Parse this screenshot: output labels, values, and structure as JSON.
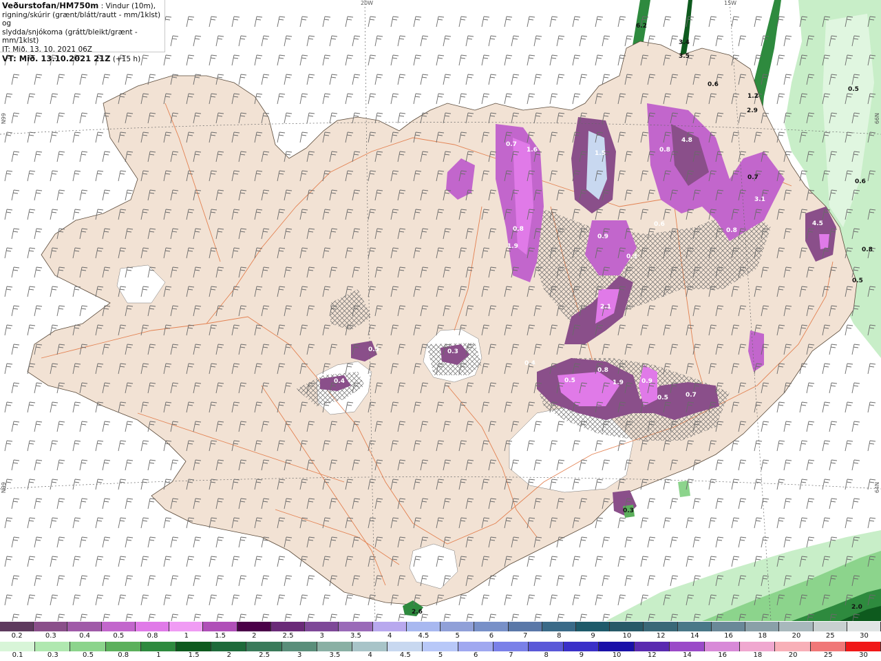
{
  "header": {
    "source": "Veðurstofan/HM750m",
    "description_line1": " : Vindur (10m),",
    "description_line2": "rigning/skúrir (grænt/blátt/rautt - mm/1klst) og",
    "description_line3": "slydda/snjókoma (grátt/bleikt/grænt - mm/1klst)",
    "initial_time": "IT: Mið. 13. 10. 2021 06Z",
    "valid_time_label": "VT: Mið. 13.10.2021 21Z",
    "valid_time_offset": "(+15 h)"
  },
  "graticule": {
    "lon_labels": [
      "20W",
      "15W"
    ],
    "lat_labels_left": [
      "N99",
      "N99"
    ],
    "lat_labels_right": [
      "66N",
      "64N"
    ]
  },
  "snow_scale": {
    "labels": [
      "0.2",
      "0.3",
      "0.4",
      "0.5",
      "0.8",
      "1",
      "1.5",
      "2",
      "2.5",
      "3",
      "3.5",
      "4",
      "4.5",
      "5",
      "6",
      "7",
      "8",
      "9",
      "10",
      "12",
      "14",
      "16",
      "18",
      "20",
      "25",
      "30"
    ],
    "colors": [
      "#5e3a5e",
      "#8a4f8a",
      "#a05aa8",
      "#c266cc",
      "#e07ae8",
      "#f09cf4",
      "#b04fb8",
      "#4a0048",
      "#6a2a78",
      "#7e4898",
      "#9a6ab8",
      "#b8a8ee",
      "#a8b8f0",
      "#90a0d8",
      "#7890c8",
      "#5a78a8",
      "#3a6a88",
      "#1e5a6a",
      "#285a68",
      "#3a6878",
      "#4a7888",
      "#6a8898",
      "#8aa0a8",
      "#a8b8bc",
      "#c8d0d0",
      "#e0e4e4"
    ]
  },
  "rain_scale": {
    "labels": [
      "0.1",
      "0.3",
      "0.5",
      "0.8",
      "1",
      "1.5",
      "2",
      "2.5",
      "3",
      "3.5",
      "4",
      "4.5",
      "5",
      "6",
      "7",
      "8",
      "9",
      "10",
      "12",
      "14",
      "16",
      "18",
      "20",
      "25",
      "30"
    ],
    "colors": [
      "#d8f5d8",
      "#b0e8b0",
      "#8cd48c",
      "#5cb05c",
      "#2e8a3e",
      "#0e5a1e",
      "#1e6a3a",
      "#3a7a5a",
      "#5a8e7a",
      "#8ab0a4",
      "#a8c4c8",
      "#c8d8f0",
      "#b8c8f8",
      "#a0a8f0",
      "#7a80e8",
      "#5a58d8",
      "#3a30c8",
      "#1a10a8",
      "#5a2ab0",
      "#9a4ac8",
      "#d88ad8",
      "#f0a8d0",
      "#f8b0b8",
      "#f07878",
      "#f01818"
    ]
  },
  "map_values": {
    "snow": [
      "0.5",
      "0.3",
      "0.4",
      "0.7",
      "1.6",
      "0.8",
      "1.9",
      "0.5",
      "0.8",
      "1.9",
      "0.9",
      "0.5",
      "0.7",
      "0.8",
      "4.8",
      "1.5",
      "3.1",
      "0.8",
      "4.5",
      "2.1",
      "0.9",
      "0.6",
      "0.3",
      "0.4"
    ],
    "rain": [
      "6.2",
      "3.4",
      "3.5",
      "0.6",
      "1.2",
      "2.9",
      "0.5",
      "0.6",
      "0.8",
      "2.0",
      "2.6",
      "0.7",
      "0.3",
      "0.5"
    ]
  }
}
